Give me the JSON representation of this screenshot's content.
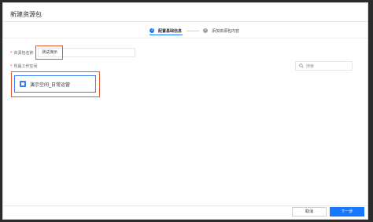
{
  "modal": {
    "title": "新建资源包"
  },
  "steps": [
    {
      "number": "1",
      "label": "配置基础信息",
      "active": true
    },
    {
      "number": "2",
      "label": "添加资源包内容",
      "active": false
    }
  ],
  "form": {
    "name_label": "资源包名称",
    "name_value": "测试演示",
    "workspace_label": "所属工作空间",
    "search_placeholder": "搜索"
  },
  "workspaces": [
    {
      "label": "演示空间_日常运营"
    }
  ],
  "footer": {
    "cancel_label": "取消",
    "next_label": "下一步"
  },
  "colors": {
    "primary": "#1677ff",
    "highlight": "#e05a2b",
    "required": "#e34d59"
  }
}
